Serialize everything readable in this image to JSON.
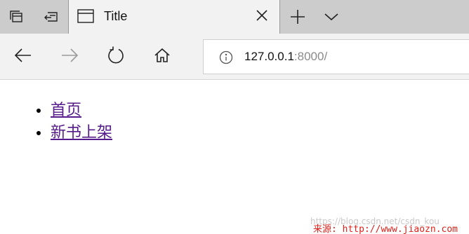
{
  "tab": {
    "title": "Title"
  },
  "address_bar": {
    "host": "127.0.0.1",
    "port_path": ":8000/"
  },
  "page": {
    "links": [
      {
        "label": "首页"
      },
      {
        "label": "新书上架"
      }
    ]
  },
  "watermark": {
    "faint_text": "https://blog.csdn.net/csdn_kou",
    "source_text": "来源: http://www.jiaozn.com"
  },
  "icons": {
    "tab_actions": [
      "tabs-aside-icon",
      "restore-tabs-icon"
    ],
    "tab": [
      "page-icon",
      "close-icon"
    ],
    "strip": [
      "new-tab-plus-icon",
      "chevron-down-icon"
    ],
    "navigation": [
      "back-arrow-icon",
      "forward-arrow-icon",
      "refresh-icon",
      "home-icon",
      "info-icon"
    ]
  },
  "colors": {
    "tabstrip_bg": "#cccccc",
    "active_tab_bg": "#f2f2f2",
    "visited_link": "#551a8b",
    "watermark_red": "#e0201a"
  }
}
